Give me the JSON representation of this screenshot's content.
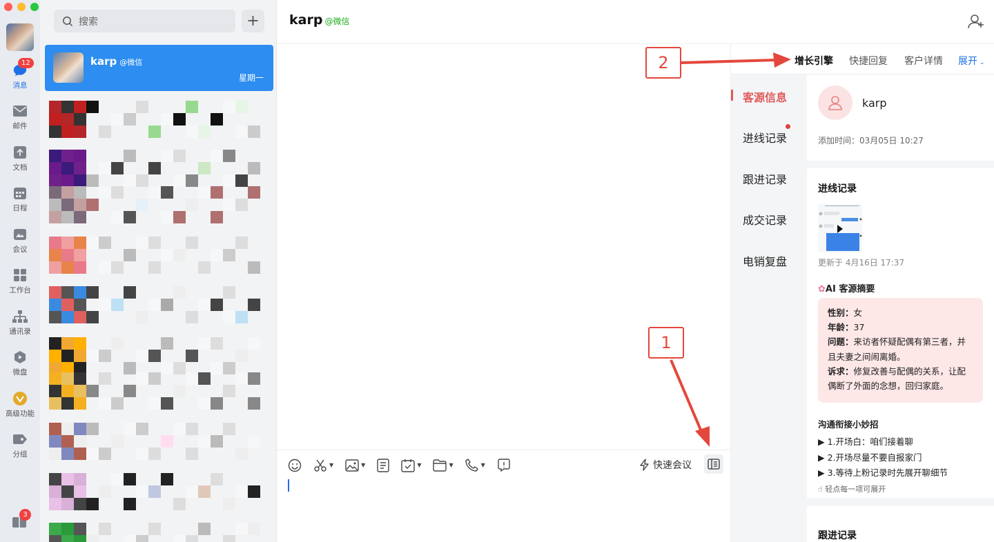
{
  "nav": {
    "items": [
      {
        "label": "消息",
        "badge": "12",
        "icon": "chat-bubble-icon"
      },
      {
        "label": "邮件",
        "icon": "mail-icon"
      },
      {
        "label": "文档",
        "icon": "document-icon"
      },
      {
        "label": "日程",
        "icon": "calendar-icon"
      },
      {
        "label": "会议",
        "icon": "meeting-icon"
      },
      {
        "label": "工作台",
        "icon": "workbench-icon"
      },
      {
        "label": "通讯录",
        "icon": "contacts-icon"
      },
      {
        "label": "微盘",
        "icon": "drive-icon"
      },
      {
        "label": "高级功能",
        "icon": "premium-icon"
      },
      {
        "label": "分组",
        "icon": "tag-icon"
      }
    ],
    "bottom_badge": "3"
  },
  "conversations": {
    "search_placeholder": "搜索",
    "active": {
      "name": "karp",
      "source": "@微信",
      "date": "星期一"
    }
  },
  "chat": {
    "title": "karp",
    "source": "@微信",
    "quick_meeting": "快速会议"
  },
  "panel": {
    "tabs": [
      {
        "label": "增长引擎",
        "active": true
      },
      {
        "label": "快捷回复"
      },
      {
        "label": "客户详情"
      },
      {
        "label": "展开"
      }
    ],
    "side_nav": [
      "客源信息",
      "进线记录",
      "跟进记录",
      "成交记录",
      "电销复盘"
    ],
    "profile": {
      "name": "karp",
      "added_time": "添加时间：03月05日 10:27"
    },
    "lead_record": {
      "title": "进线记录",
      "updated": "更新于 4月16日 17:37"
    },
    "ai_summary": {
      "title": "AI 客源摘要",
      "lines": [
        {
          "k": "性别：",
          "v": "女"
        },
        {
          "k": "年龄：",
          "v": "37"
        },
        {
          "k": "问题：",
          "v": "来访者怀疑配偶有第三者，并且夫妻之间闹离婚。"
        },
        {
          "k": "诉求：",
          "v": "修复改善与配偶的关系，让配偶断了外面的念想，回归家庭。"
        }
      ]
    },
    "tips": {
      "title": "沟通衔接小妙招",
      "items": [
        "▶ 1.开场白：咱们接着聊",
        "▶ 2.开场尽量不要自报家门",
        "▶ 3.等待上粉记录时先展开聊细节"
      ],
      "hint": "轻点每一项可展开"
    },
    "follow_record_title": "跟进记录"
  },
  "annotations": {
    "one": "1",
    "two": "2"
  },
  "colors": {
    "accent": "#2d8df0",
    "highlight": "#e05a5a",
    "annotation": "#e4473c"
  }
}
